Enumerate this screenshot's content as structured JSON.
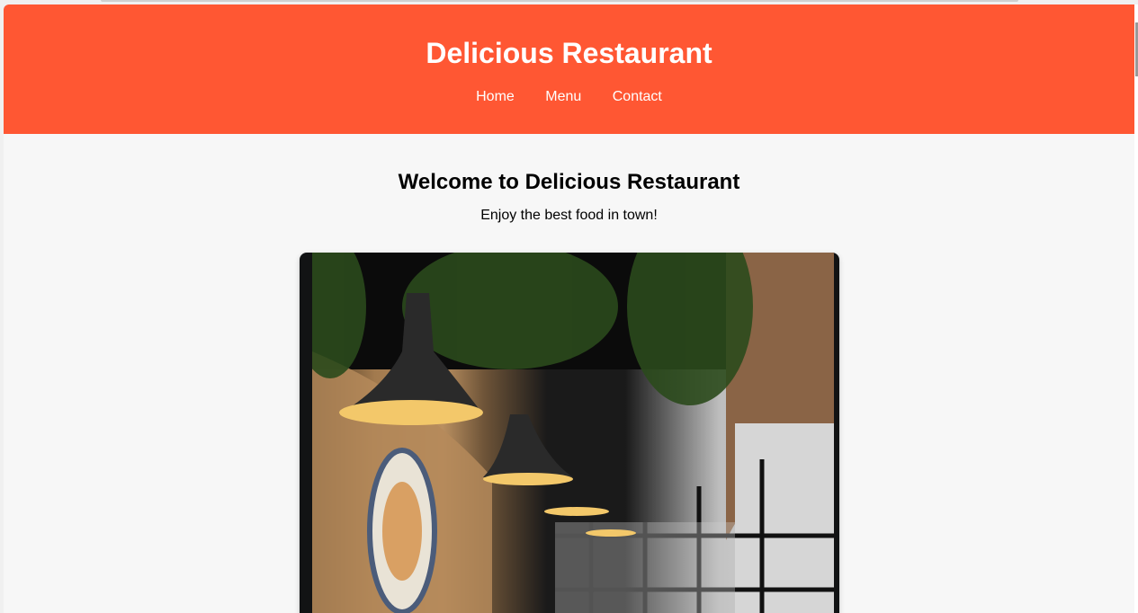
{
  "header": {
    "title": "Delicious Restaurant"
  },
  "nav": [
    {
      "label": "Home"
    },
    {
      "label": "Menu"
    },
    {
      "label": "Contact"
    }
  ],
  "main": {
    "heading": "Welcome to Delicious Restaurant",
    "tagline": "Enjoy the best food in town!"
  },
  "colors": {
    "brand": "#FF5733",
    "background": "#f7f7f7"
  }
}
